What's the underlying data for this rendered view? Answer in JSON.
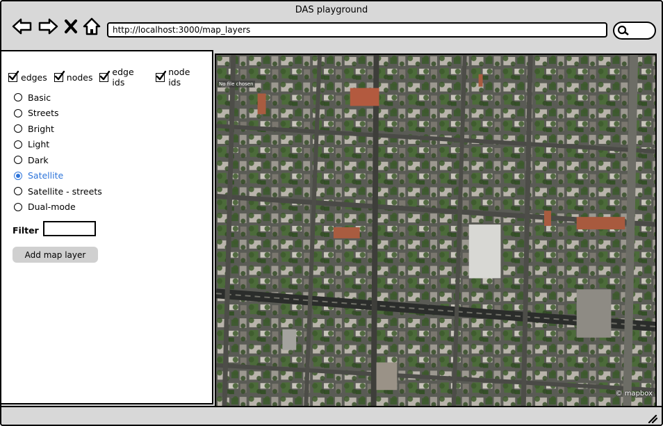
{
  "window": {
    "title": "DAS playground"
  },
  "toolbar": {
    "back_icon": "back-arrow-icon",
    "forward_icon": "forward-arrow-icon",
    "close_icon": "close-x-icon",
    "home_icon": "home-icon",
    "url": "http://localhost:3000/map_layers",
    "search_icon": "search-icon"
  },
  "sidebar": {
    "checkboxes": [
      {
        "label": "edges",
        "checked": true
      },
      {
        "label": "nodes",
        "checked": true
      },
      {
        "label": "edge ids",
        "checked": true
      },
      {
        "label": "node ids",
        "checked": true
      }
    ],
    "radios": [
      {
        "label": "Basic",
        "selected": false
      },
      {
        "label": "Streets",
        "selected": false
      },
      {
        "label": "Bright",
        "selected": false
      },
      {
        "label": "Light",
        "selected": false
      },
      {
        "label": "Dark",
        "selected": false
      },
      {
        "label": "Satellite",
        "selected": true
      },
      {
        "label": "Satellite - streets",
        "selected": false
      },
      {
        "label": "Dual-mode",
        "selected": false
      }
    ],
    "filter_label": "Filter",
    "filter_value": "",
    "add_button": "Add map layer"
  },
  "map": {
    "no_file_label": "No file chosen",
    "attribution": "© mapbox"
  },
  "colors": {
    "accent": "#2d74da",
    "chrome": "#d8d8d8"
  }
}
